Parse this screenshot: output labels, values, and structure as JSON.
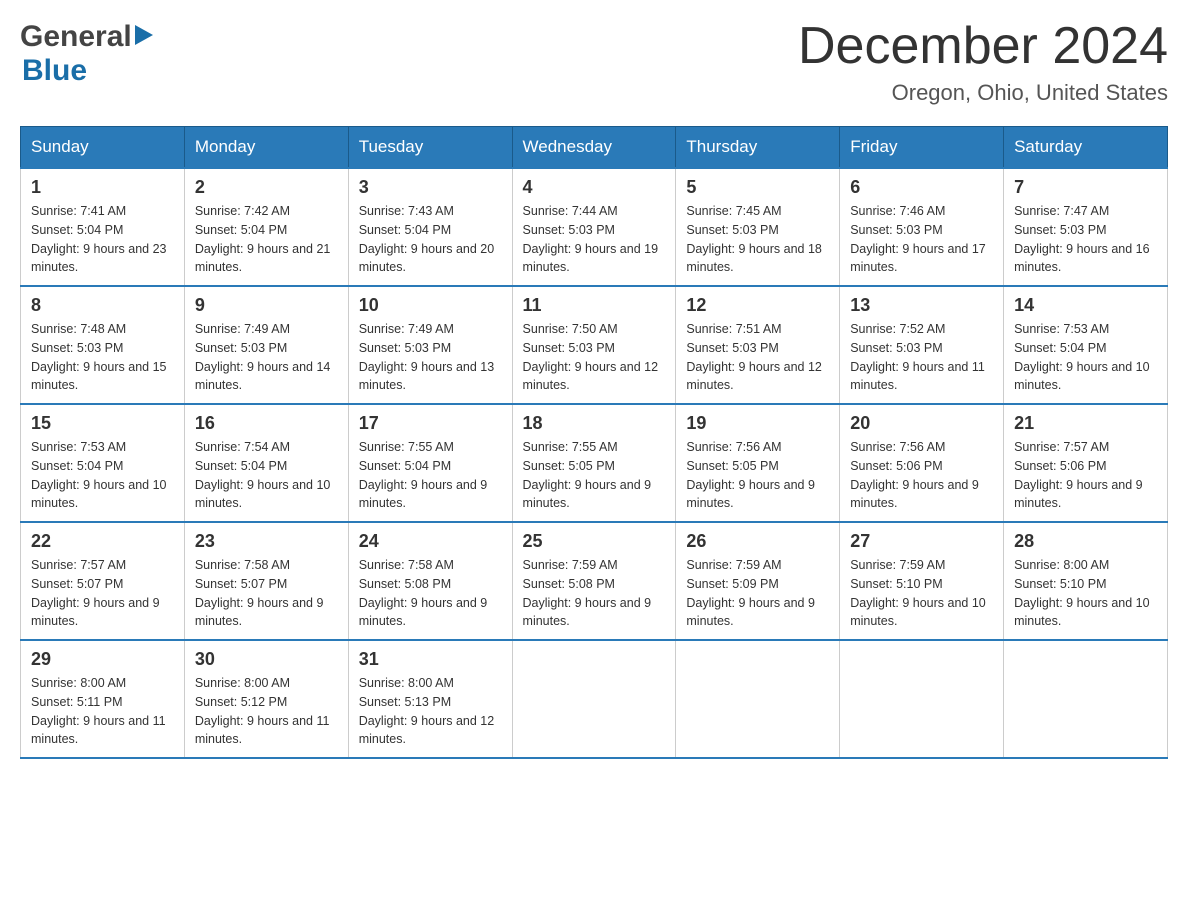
{
  "logo": {
    "general": "General",
    "blue": "Blue",
    "arrow_color": "#1a6ea8"
  },
  "title": {
    "month_year": "December 2024",
    "location": "Oregon, Ohio, United States"
  },
  "headers": [
    "Sunday",
    "Monday",
    "Tuesday",
    "Wednesday",
    "Thursday",
    "Friday",
    "Saturday"
  ],
  "weeks": [
    [
      {
        "day": "1",
        "sunrise": "Sunrise: 7:41 AM",
        "sunset": "Sunset: 5:04 PM",
        "daylight": "Daylight: 9 hours and 23 minutes."
      },
      {
        "day": "2",
        "sunrise": "Sunrise: 7:42 AM",
        "sunset": "Sunset: 5:04 PM",
        "daylight": "Daylight: 9 hours and 21 minutes."
      },
      {
        "day": "3",
        "sunrise": "Sunrise: 7:43 AM",
        "sunset": "Sunset: 5:04 PM",
        "daylight": "Daylight: 9 hours and 20 minutes."
      },
      {
        "day": "4",
        "sunrise": "Sunrise: 7:44 AM",
        "sunset": "Sunset: 5:03 PM",
        "daylight": "Daylight: 9 hours and 19 minutes."
      },
      {
        "day": "5",
        "sunrise": "Sunrise: 7:45 AM",
        "sunset": "Sunset: 5:03 PM",
        "daylight": "Daylight: 9 hours and 18 minutes."
      },
      {
        "day": "6",
        "sunrise": "Sunrise: 7:46 AM",
        "sunset": "Sunset: 5:03 PM",
        "daylight": "Daylight: 9 hours and 17 minutes."
      },
      {
        "day": "7",
        "sunrise": "Sunrise: 7:47 AM",
        "sunset": "Sunset: 5:03 PM",
        "daylight": "Daylight: 9 hours and 16 minutes."
      }
    ],
    [
      {
        "day": "8",
        "sunrise": "Sunrise: 7:48 AM",
        "sunset": "Sunset: 5:03 PM",
        "daylight": "Daylight: 9 hours and 15 minutes."
      },
      {
        "day": "9",
        "sunrise": "Sunrise: 7:49 AM",
        "sunset": "Sunset: 5:03 PM",
        "daylight": "Daylight: 9 hours and 14 minutes."
      },
      {
        "day": "10",
        "sunrise": "Sunrise: 7:49 AM",
        "sunset": "Sunset: 5:03 PM",
        "daylight": "Daylight: 9 hours and 13 minutes."
      },
      {
        "day": "11",
        "sunrise": "Sunrise: 7:50 AM",
        "sunset": "Sunset: 5:03 PM",
        "daylight": "Daylight: 9 hours and 12 minutes."
      },
      {
        "day": "12",
        "sunrise": "Sunrise: 7:51 AM",
        "sunset": "Sunset: 5:03 PM",
        "daylight": "Daylight: 9 hours and 12 minutes."
      },
      {
        "day": "13",
        "sunrise": "Sunrise: 7:52 AM",
        "sunset": "Sunset: 5:03 PM",
        "daylight": "Daylight: 9 hours and 11 minutes."
      },
      {
        "day": "14",
        "sunrise": "Sunrise: 7:53 AM",
        "sunset": "Sunset: 5:04 PM",
        "daylight": "Daylight: 9 hours and 10 minutes."
      }
    ],
    [
      {
        "day": "15",
        "sunrise": "Sunrise: 7:53 AM",
        "sunset": "Sunset: 5:04 PM",
        "daylight": "Daylight: 9 hours and 10 minutes."
      },
      {
        "day": "16",
        "sunrise": "Sunrise: 7:54 AM",
        "sunset": "Sunset: 5:04 PM",
        "daylight": "Daylight: 9 hours and 10 minutes."
      },
      {
        "day": "17",
        "sunrise": "Sunrise: 7:55 AM",
        "sunset": "Sunset: 5:04 PM",
        "daylight": "Daylight: 9 hours and 9 minutes."
      },
      {
        "day": "18",
        "sunrise": "Sunrise: 7:55 AM",
        "sunset": "Sunset: 5:05 PM",
        "daylight": "Daylight: 9 hours and 9 minutes."
      },
      {
        "day": "19",
        "sunrise": "Sunrise: 7:56 AM",
        "sunset": "Sunset: 5:05 PM",
        "daylight": "Daylight: 9 hours and 9 minutes."
      },
      {
        "day": "20",
        "sunrise": "Sunrise: 7:56 AM",
        "sunset": "Sunset: 5:06 PM",
        "daylight": "Daylight: 9 hours and 9 minutes."
      },
      {
        "day": "21",
        "sunrise": "Sunrise: 7:57 AM",
        "sunset": "Sunset: 5:06 PM",
        "daylight": "Daylight: 9 hours and 9 minutes."
      }
    ],
    [
      {
        "day": "22",
        "sunrise": "Sunrise: 7:57 AM",
        "sunset": "Sunset: 5:07 PM",
        "daylight": "Daylight: 9 hours and 9 minutes."
      },
      {
        "day": "23",
        "sunrise": "Sunrise: 7:58 AM",
        "sunset": "Sunset: 5:07 PM",
        "daylight": "Daylight: 9 hours and 9 minutes."
      },
      {
        "day": "24",
        "sunrise": "Sunrise: 7:58 AM",
        "sunset": "Sunset: 5:08 PM",
        "daylight": "Daylight: 9 hours and 9 minutes."
      },
      {
        "day": "25",
        "sunrise": "Sunrise: 7:59 AM",
        "sunset": "Sunset: 5:08 PM",
        "daylight": "Daylight: 9 hours and 9 minutes."
      },
      {
        "day": "26",
        "sunrise": "Sunrise: 7:59 AM",
        "sunset": "Sunset: 5:09 PM",
        "daylight": "Daylight: 9 hours and 9 minutes."
      },
      {
        "day": "27",
        "sunrise": "Sunrise: 7:59 AM",
        "sunset": "Sunset: 5:10 PM",
        "daylight": "Daylight: 9 hours and 10 minutes."
      },
      {
        "day": "28",
        "sunrise": "Sunrise: 8:00 AM",
        "sunset": "Sunset: 5:10 PM",
        "daylight": "Daylight: 9 hours and 10 minutes."
      }
    ],
    [
      {
        "day": "29",
        "sunrise": "Sunrise: 8:00 AM",
        "sunset": "Sunset: 5:11 PM",
        "daylight": "Daylight: 9 hours and 11 minutes."
      },
      {
        "day": "30",
        "sunrise": "Sunrise: 8:00 AM",
        "sunset": "Sunset: 5:12 PM",
        "daylight": "Daylight: 9 hours and 11 minutes."
      },
      {
        "day": "31",
        "sunrise": "Sunrise: 8:00 AM",
        "sunset": "Sunset: 5:13 PM",
        "daylight": "Daylight: 9 hours and 12 minutes."
      },
      null,
      null,
      null,
      null
    ]
  ]
}
